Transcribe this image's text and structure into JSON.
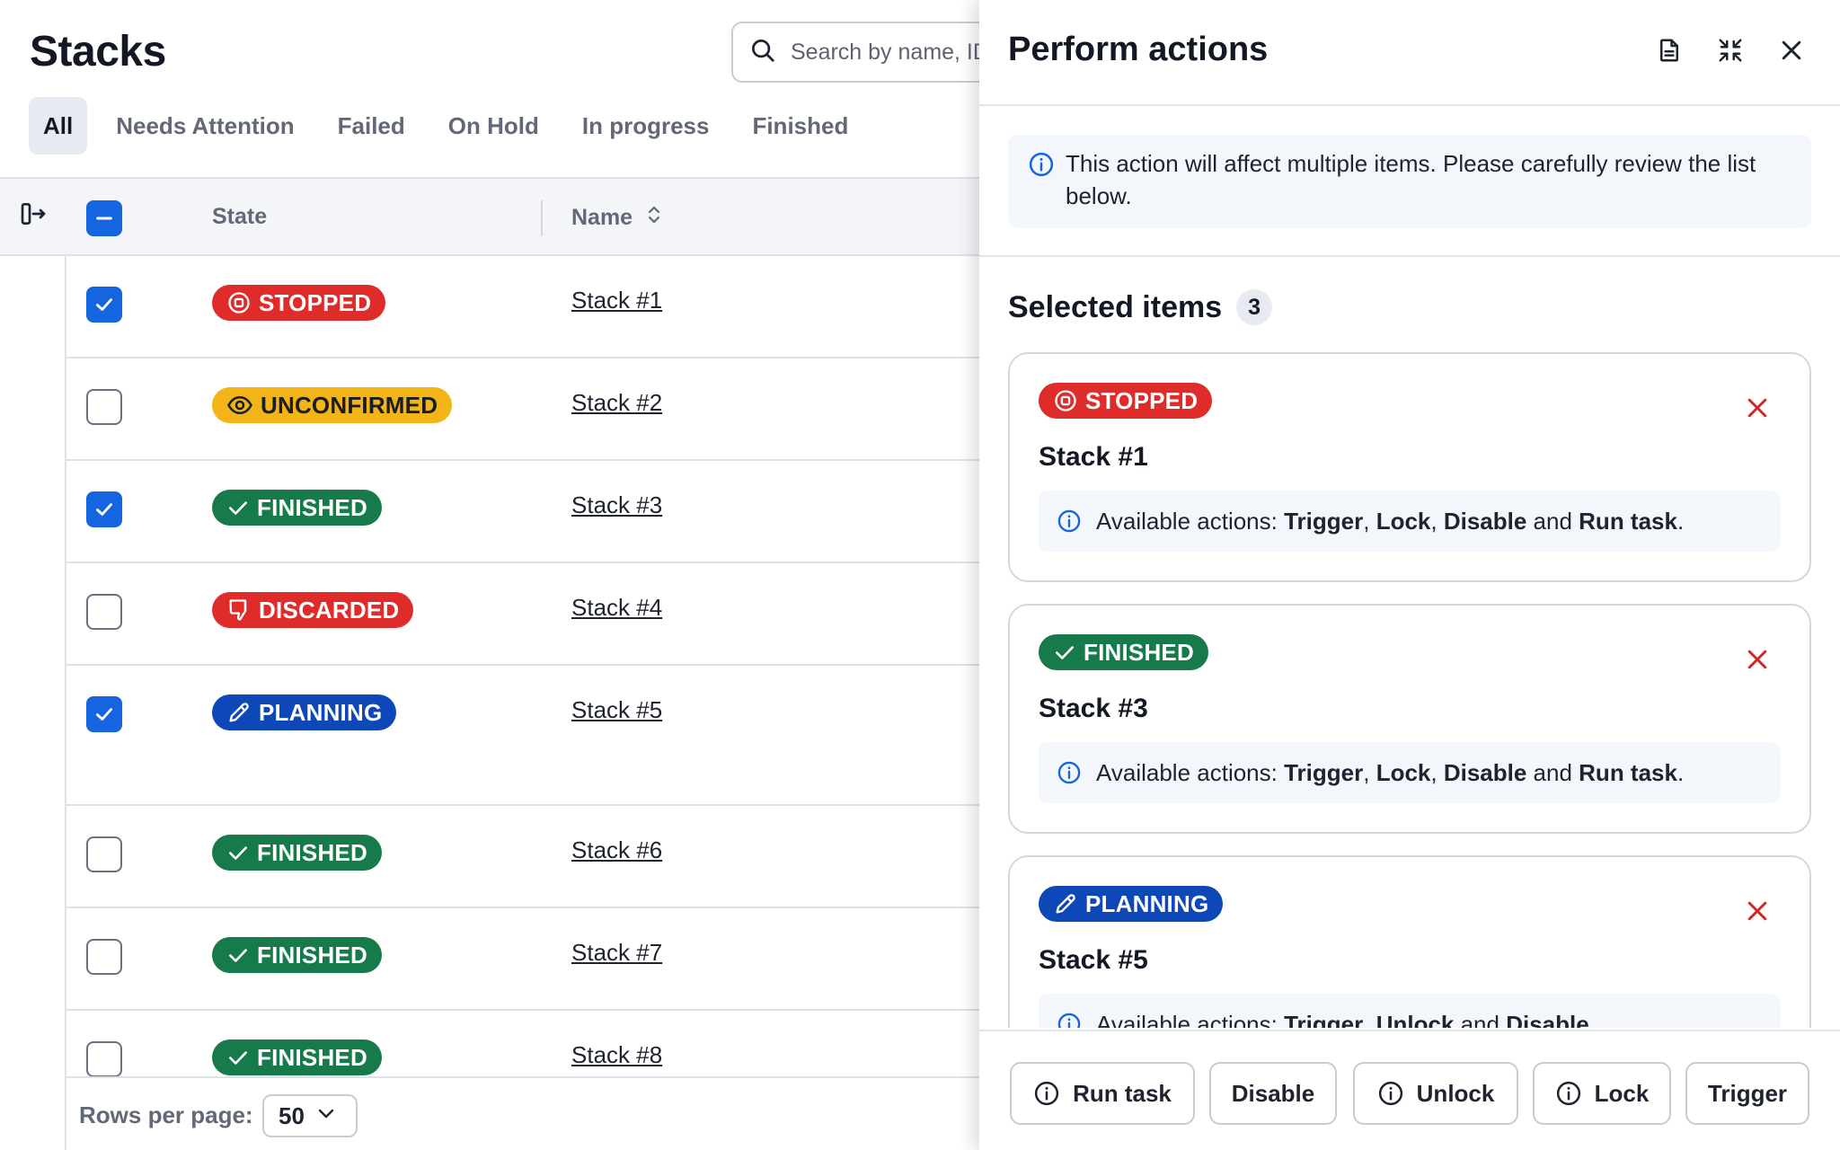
{
  "page": {
    "title": "Stacks"
  },
  "search": {
    "placeholder": "Search by name, ID"
  },
  "tabs": [
    {
      "label": "All",
      "active": true
    },
    {
      "label": "Needs Attention"
    },
    {
      "label": "Failed"
    },
    {
      "label": "On Hold"
    },
    {
      "label": "In progress"
    },
    {
      "label": "Finished"
    }
  ],
  "table": {
    "columns": {
      "state": "State",
      "name": "Name"
    },
    "rows": [
      {
        "state": "STOPPED",
        "name": "Stack #1",
        "checked": true
      },
      {
        "state": "UNCONFIRMED",
        "name": "Stack #2",
        "checked": false
      },
      {
        "state": "FINISHED",
        "name": "Stack #3",
        "checked": true
      },
      {
        "state": "DISCARDED",
        "name": "Stack #4",
        "checked": false
      },
      {
        "state": "PLANNING",
        "name": "Stack #5",
        "checked": true
      },
      {
        "state": "FINISHED",
        "name": "Stack #6",
        "checked": false
      },
      {
        "state": "FINISHED",
        "name": "Stack #7",
        "checked": false
      },
      {
        "state": "FINISHED",
        "name": "Stack #8",
        "checked": false
      }
    ]
  },
  "footer": {
    "rows_per_page_label": "Rows per page:",
    "rows_per_page_value": "50"
  },
  "drawer": {
    "title": "Perform actions",
    "notice": "This action will affect multiple items. Please carefully review the list below.",
    "selected_title": "Selected items",
    "selected_count": "3",
    "items": [
      {
        "state": "STOPPED",
        "name": "Stack #1",
        "actions_prefix": "Available actions: ",
        "actions": [
          "Trigger",
          "Lock",
          "Disable",
          "Run task"
        ]
      },
      {
        "state": "FINISHED",
        "name": "Stack #3",
        "actions_prefix": "Available actions: ",
        "actions": [
          "Trigger",
          "Lock",
          "Disable",
          "Run task"
        ]
      },
      {
        "state": "PLANNING",
        "name": "Stack #5",
        "actions_prefix": "Available actions: ",
        "actions": [
          "Trigger",
          "Unlock",
          "Disable"
        ]
      }
    ],
    "buttons": {
      "run_task": "Run task",
      "disable": "Disable",
      "unlock": "Unlock",
      "lock": "Lock",
      "trigger": "Trigger"
    }
  },
  "colors": {
    "accent": "#1565e0",
    "stopped": "#e02b2b",
    "discarded": "#e02b2b",
    "finished": "#167a4a",
    "unconfirmed": "#f2b416",
    "planning": "#0d47b8",
    "remove_icon": "#d32626"
  },
  "icons": {
    "search": "search-icon",
    "collapse_sidebar": "collapse-sidebar-icon",
    "sort": "sort-icon",
    "document": "document-icon",
    "minimize": "minimize-icon",
    "close": "close-icon",
    "info": "info-icon",
    "remove": "remove-icon",
    "chevron": "chevron-down-icon"
  }
}
